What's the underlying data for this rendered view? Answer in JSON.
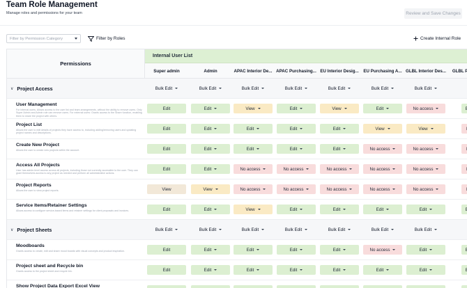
{
  "page": {
    "title": "Team Role Management",
    "subtitle": "Manage roles and permissions for your team",
    "review_button": "Review and Save Changes"
  },
  "toolbar": {
    "category_placeholder": "Filter by Permission Category",
    "filter_roles_label": "Filter by Roles",
    "create_role_label": "Create Internal Role"
  },
  "table": {
    "permissions_header": "Permissions",
    "group_label": "Internal User List",
    "columns": [
      "Super admin",
      "Admin",
      "APAC Interior De...",
      "APAC Purchasing...",
      "EU Interior Desig...",
      "EU Purchasing A...",
      "GLBL Interior Des...",
      "GLBL Pu"
    ],
    "bulk_label": "Bulk Edit"
  },
  "sections": [
    {
      "label": "Project Access",
      "rows": [
        {
          "name": "User Management",
          "desc": "For internal users. Allows access to the user list and team arrangements, without the ability to remove users. Only Super Admin and Admin role can remove users. For external users: Grants access to the Share function, enabling them to share the project with others.",
          "values": [
            "Edit",
            "Edit",
            "View",
            "Edit",
            "View",
            "Edit",
            "No access",
            "Edit"
          ]
        },
        {
          "name": "Project List",
          "desc": "Allows the user to edit details of projects they have access to, including adding/removing users and updating project names and descriptions.",
          "values": [
            "Edit",
            "Edit",
            "Edit",
            "Edit",
            "Edit",
            "View",
            "View",
            "No"
          ]
        },
        {
          "name": "Create New Project",
          "desc": "Allows the user to create new projects within the account.",
          "values": [
            "Edit",
            "Edit",
            "Edit",
            "Edit",
            "Edit",
            "No access",
            "No access",
            "No"
          ]
        },
        {
          "name": "Access All Projects",
          "desc": "User has admin-level access across all projects, including those not currently accessible to the user. They can grant themselves access to any project as needed and perform all administrative actions.",
          "values": [
            "Edit",
            "Edit",
            "No access",
            "No access",
            "No access",
            "No access",
            "No access",
            "No"
          ]
        },
        {
          "name": "Project Reports",
          "desc": "Allows the user to view project reports.",
          "values": [
            "View",
            "View",
            "No access",
            "No access",
            "No access",
            "No access",
            "No access",
            "No"
          ]
        },
        {
          "name": "Service Items/Retainer Settings",
          "desc": "Allows access to configure service-based items and retainer settings for client proposals and invoices.",
          "values": [
            "Edit",
            "Edit",
            "View",
            "Edit",
            "Edit",
            "Edit",
            "Edit",
            "Edit"
          ]
        }
      ]
    },
    {
      "label": "Project Sheets",
      "rows": [
        {
          "name": "Moodboards",
          "desc": "Grants access to create, edit and share mood boards with visual concepts and product inspiration.",
          "values": [
            "Edit",
            "Edit",
            "Edit",
            "Edit",
            "Edit",
            "No access",
            "Edit",
            "Edit"
          ]
        },
        {
          "name": "Project sheet and Recycle bin",
          "desc": "Grants access to the project sheet and recycle bin.",
          "values": [
            "Edit",
            "Edit",
            "Edit",
            "Edit",
            "Edit",
            "Edit",
            "Edit",
            "Edit"
          ]
        },
        {
          "name": "Show Project Data Export Excel View",
          "desc": "",
          "values": [
            "Edit",
            "Edit",
            "Edit",
            "Edit",
            "Edit",
            "Edit",
            "Edit",
            "Edit"
          ]
        }
      ]
    }
  ],
  "colors": {
    "edit": "#dcefd1",
    "view": "#faeac4",
    "no_access": "#f8dcdc",
    "group_band": "#ddf0d3"
  },
  "icons": {
    "create": "plus-icon",
    "filter": "filter-icon",
    "section_toggle": "chevron-down-icon"
  }
}
